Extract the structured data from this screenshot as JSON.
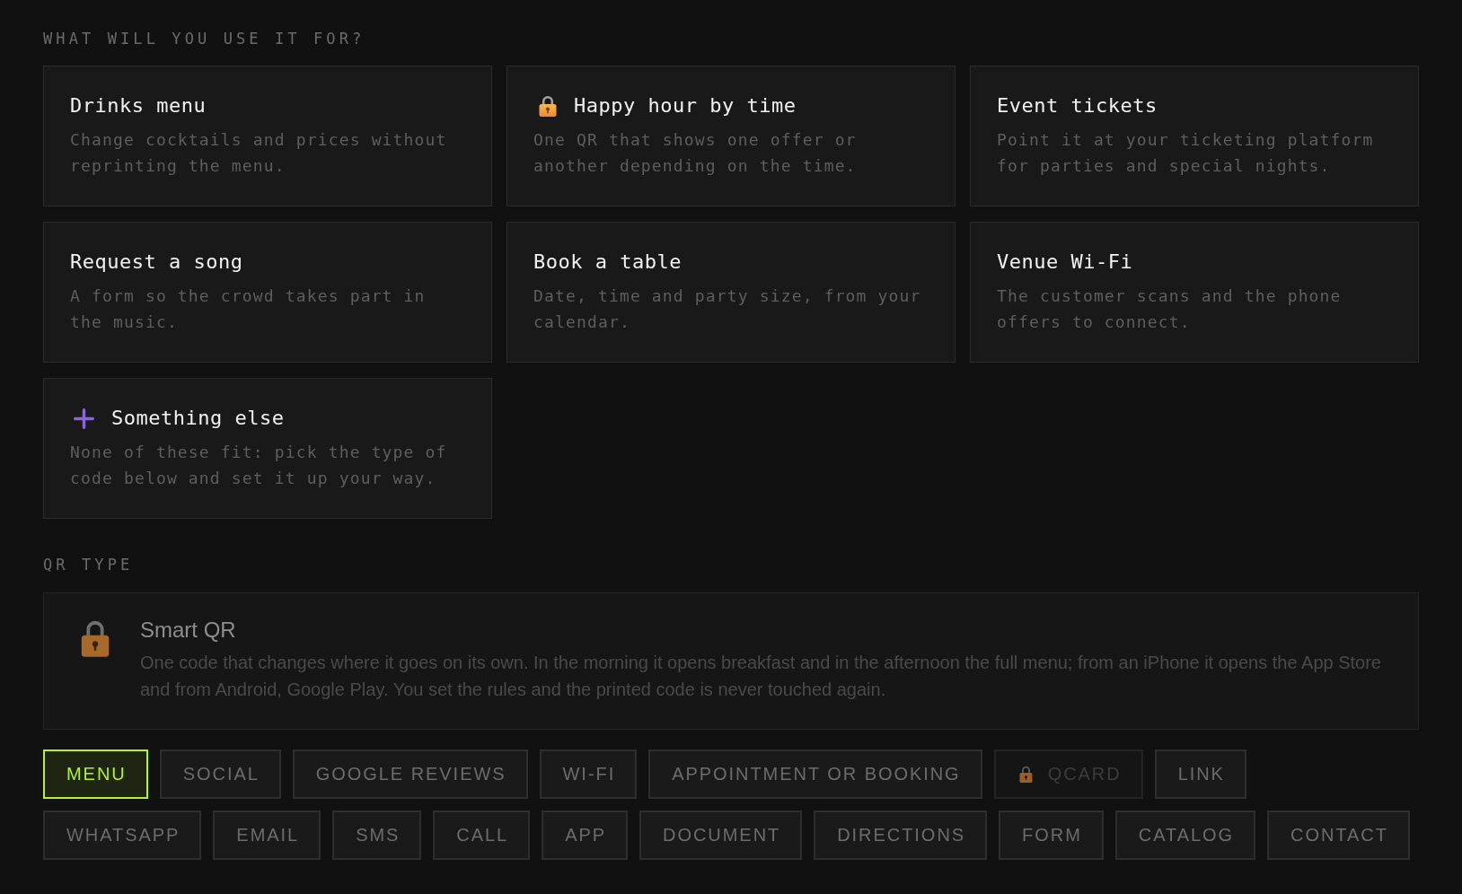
{
  "use_section": {
    "label": "WHAT WILL YOU USE IT FOR?",
    "cards": [
      {
        "kind": "option",
        "title": "Drinks menu",
        "description": "Change cocktails and prices without reprinting the menu.",
        "locked": false,
        "selected": false
      },
      {
        "kind": "option",
        "title": "Happy hour by time",
        "description": "One QR that shows one offer or another depending on the time.",
        "locked": true,
        "selected": false
      },
      {
        "kind": "option",
        "title": "Event tickets",
        "description": "Point it at your ticketing platform for parties and special nights.",
        "locked": false,
        "selected": false
      },
      {
        "kind": "option",
        "title": "Request a song",
        "description": "A form so the crowd takes part in the music.",
        "locked": false,
        "selected": false
      },
      {
        "kind": "option",
        "title": "Book a table",
        "description": "Date, time and party size, from your calendar.",
        "locked": false,
        "selected": false
      },
      {
        "kind": "option",
        "title": "Venue Wi-Fi",
        "description": "The customer scans and the phone offers to connect.",
        "locked": false,
        "selected": false
      },
      {
        "kind": "other",
        "title": "Something else",
        "description": "None of these fit: pick the type of code below and set it up your way.",
        "locked": false,
        "selected": false
      }
    ]
  },
  "type_section": {
    "label": "QR TYPE",
    "smart_qr": {
      "title": "Smart QR",
      "description": "One code that changes where it goes on its own. In the morning it opens breakfast and in the afternoon the full menu; from an iPhone it opens the App Store and from Android, Google Play. You set the rules and the printed code is never touched again.",
      "locked": true
    },
    "rows": [
      {
        "items": [
          {
            "label": "MENU",
            "selected": true,
            "locked": false
          },
          {
            "label": "SOCIAL",
            "selected": false,
            "locked": false
          },
          {
            "label": "GOOGLE REVIEWS",
            "selected": false,
            "locked": false
          },
          {
            "label": "WI-FI",
            "selected": false,
            "locked": false
          },
          {
            "label": "APPOINTMENT OR BOOKING",
            "selected": false,
            "locked": false
          },
          {
            "label": "QCARD",
            "selected": false,
            "locked": true
          },
          {
            "label": "LINK",
            "selected": false,
            "locked": false
          }
        ]
      },
      {
        "items": [
          {
            "label": "WHATSAPP",
            "selected": false,
            "locked": false
          },
          {
            "label": "EMAIL",
            "selected": false,
            "locked": false
          },
          {
            "label": "SMS",
            "selected": false,
            "locked": false
          },
          {
            "label": "CALL",
            "selected": false,
            "locked": false
          },
          {
            "label": "APP",
            "selected": false,
            "locked": false
          },
          {
            "label": "DOCUMENT",
            "selected": false,
            "locked": false
          },
          {
            "label": "DIRECTIONS",
            "selected": false,
            "locked": false
          },
          {
            "label": "FORM",
            "selected": false,
            "locked": false
          },
          {
            "label": "CATALOG",
            "selected": false,
            "locked": false
          },
          {
            "label": "CONTACT",
            "selected": false,
            "locked": false
          }
        ]
      }
    ]
  }
}
